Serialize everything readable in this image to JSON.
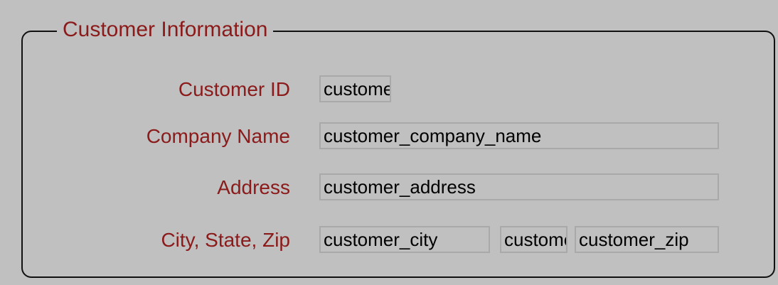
{
  "group": {
    "title": "Customer Information"
  },
  "fields": {
    "customer_id": {
      "label": "Customer ID",
      "value": "customer_id"
    },
    "company_name": {
      "label": "Company Name",
      "value": "customer_company_name"
    },
    "address": {
      "label": "Address",
      "value": "customer_address"
    },
    "city_state_zip": {
      "label": "City, State, Zip",
      "city": "customer_city",
      "state": "customer_state",
      "zip": "customer_zip"
    }
  },
  "colors": {
    "background": "#c0c0c0",
    "label_text": "#8b1a1a",
    "field_border": "#a9a9a9",
    "group_border": "#111111"
  }
}
